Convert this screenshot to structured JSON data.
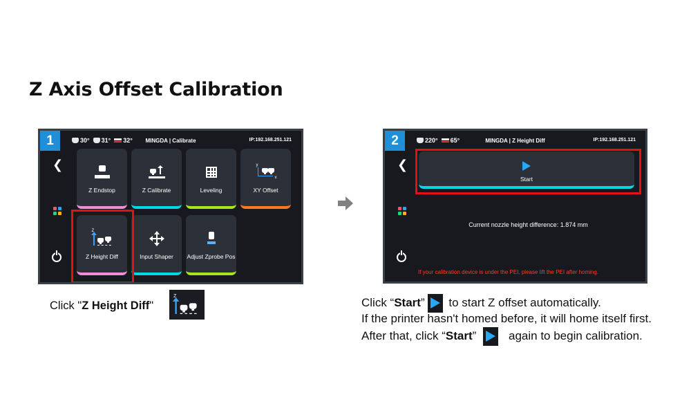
{
  "page_title": "Z Axis Offset Calibration",
  "screen1": {
    "step": "1",
    "status": {
      "temp1": "30°",
      "temp2": "31°",
      "temp3": "32°",
      "title": "MINGDA | Calibrate",
      "ip": "IP:192.168.251.121"
    },
    "tiles": [
      {
        "label": "Z Endstop",
        "icon": "z-endstop-icon",
        "accent": "#00d8e8"
      },
      {
        "label": "Z Calibrate",
        "icon": "z-calibrate-icon",
        "accent": "#00d8e8"
      },
      {
        "label": "Leveling",
        "icon": "grid-icon",
        "accent": "#a8e81a"
      },
      {
        "label": "XY Offset",
        "icon": "xy-offset-icon",
        "accent": "#ff7a1a"
      },
      {
        "label": "Z Height Diff",
        "icon": "z-height-diff-icon",
        "accent": "#f08cd8"
      },
      {
        "label": "Input Shaper",
        "icon": "move-arrows-icon",
        "accent": "#00d8e8"
      },
      {
        "label": "Adjust Zprobe Pos",
        "icon": "zprobe-icon",
        "accent": "#a8e81a"
      }
    ]
  },
  "screen2": {
    "step": "2",
    "status": {
      "temp1": "220°",
      "temp2": "65°",
      "title": "MINGDA  | Z Height Diff",
      "ip": "IP:192.168.251.121"
    },
    "start_label": "Start",
    "diff_text": "Current nozzle height difference: 1.874 mm",
    "warning": "If your calibration device is under the PEI, please lift the PEI after homing."
  },
  "caption1": {
    "prefix": "Click  \"",
    "bold": "Z Height Diff",
    "suffix": "\""
  },
  "caption2": {
    "l1_a": "Click “",
    "l1_bold": "Start",
    "l1_b": "”",
    "l1_c": " to start Z offset automatically.",
    "l2": "If the printer hasn't homed before, it will home itself first.",
    "l3_a": "After that, click  “",
    "l3_bold": "Start",
    "l3_b": "”",
    "l3_c": "  again to begin calibration."
  },
  "colors": {
    "accent_blue": "#1e8fd8",
    "highlight_red": "#e31212",
    "warning_red": "#ff3b2f"
  }
}
